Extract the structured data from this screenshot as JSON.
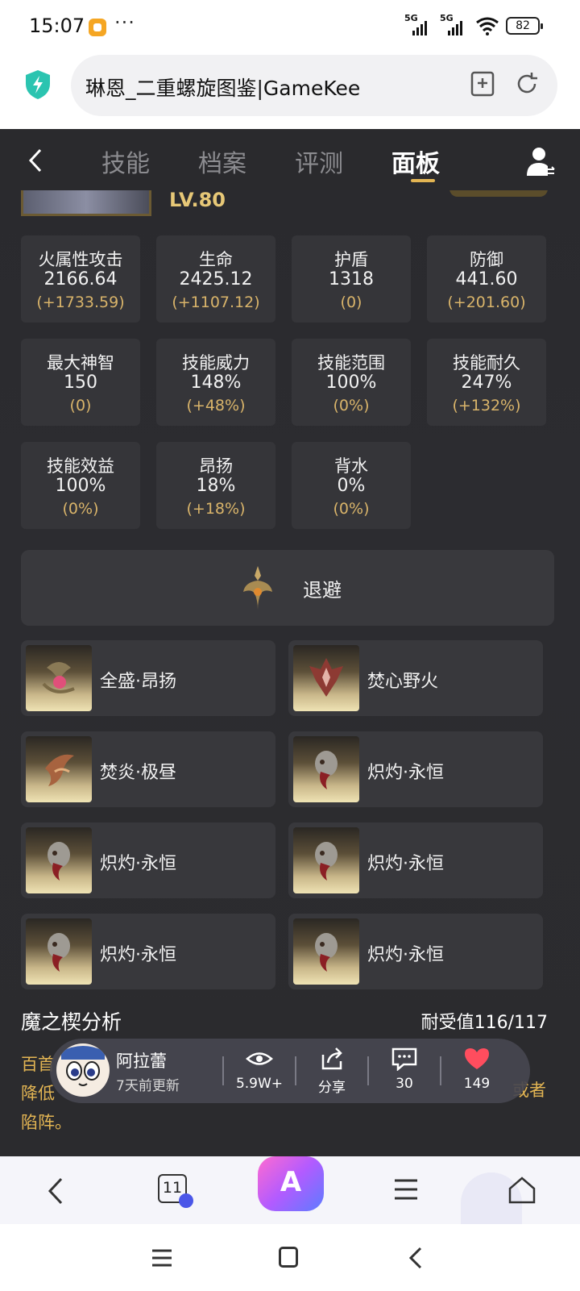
{
  "status": {
    "time": "15:07",
    "dots": "···",
    "sim1": "5G",
    "sim2": "5G",
    "battery": "82"
  },
  "address": {
    "title": "琳恩_二重螺旋图鉴|GameKee"
  },
  "nav": {
    "tabs": [
      "技能",
      "档案",
      "评测",
      "面板"
    ],
    "active_tab": "面板"
  },
  "hero": {
    "level": "LV.80"
  },
  "stats": [
    {
      "name": "火属性攻击",
      "value": "2166.64",
      "bonus": "(+1733.59)"
    },
    {
      "name": "生命",
      "value": "2425.12",
      "bonus": "(+1107.12)"
    },
    {
      "name": "护盾",
      "value": "1318",
      "bonus": "(0)"
    },
    {
      "name": "防御",
      "value": "441.60",
      "bonus": "(+201.60)"
    },
    {
      "name": "最大神智",
      "value": "150",
      "bonus": "(0)"
    },
    {
      "name": "技能威力",
      "value": "148%",
      "bonus": "(+48%)"
    },
    {
      "name": "技能范围",
      "value": "100%",
      "bonus": "(0%)"
    },
    {
      "name": "技能耐久",
      "value": "247%",
      "bonus": "(+132%)"
    },
    {
      "name": "技能效益",
      "value": "100%",
      "bonus": "(0%)"
    },
    {
      "name": "昂扬",
      "value": "18%",
      "bonus": "(+18%)"
    },
    {
      "name": "背水",
      "value": "0%",
      "bonus": "(0%)"
    }
  ],
  "retreat": {
    "label": "退避"
  },
  "runes": [
    {
      "label": "全盛·昂扬",
      "icon": "orb-serpent-icon"
    },
    {
      "label": "焚心野火",
      "icon": "flame-crest-icon"
    },
    {
      "label": "焚炎·极昼",
      "icon": "phoenix-icon"
    },
    {
      "label": "炽灼·永恒",
      "icon": "mask-icon"
    },
    {
      "label": "炽灼·永恒",
      "icon": "mask-icon"
    },
    {
      "label": "炽灼·永恒",
      "icon": "mask-icon"
    },
    {
      "label": "炽灼·永恒",
      "icon": "mask-icon"
    },
    {
      "label": "炽灼·永恒",
      "icon": "mask-icon"
    }
  ],
  "analysis": {
    "title": "魔之楔分析",
    "value": "耐受值116/117",
    "text_line1": "百首",
    "text_line2": "降低",
    "text_tail": "或者",
    "text_line3": "陷阵。"
  },
  "float_bar": {
    "author": "阿拉蕾",
    "updated": "7天前更新",
    "views": "5.9W+",
    "share": "分享",
    "comments": "30",
    "likes": "149",
    "like_color": "#ff4d5e"
  },
  "browser": {
    "tab_count": "11",
    "ai_label": "A"
  }
}
